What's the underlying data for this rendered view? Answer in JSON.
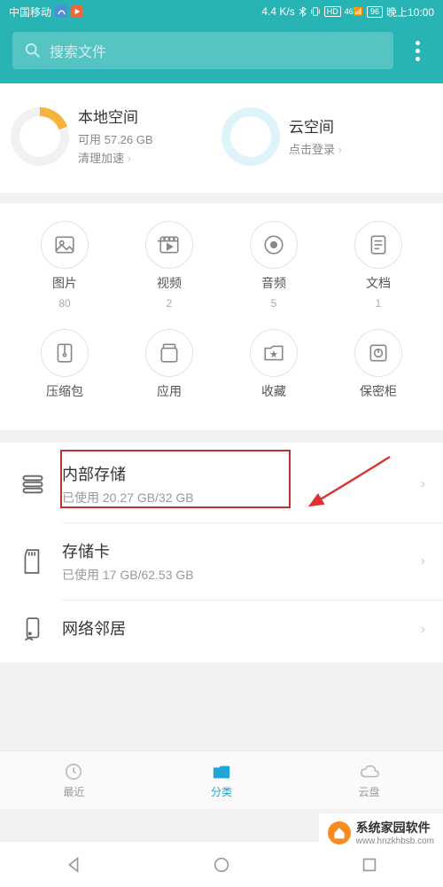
{
  "status": {
    "carrier": "中国移动",
    "netspeed": "4.4 K/s",
    "hd": "HD",
    "signal": "46",
    "battery": "96",
    "time": "晚上10:00"
  },
  "search": {
    "placeholder": "搜索文件"
  },
  "storage": {
    "local": {
      "title": "本地空间",
      "available": "可用 57.26 GB",
      "link": "清理加速"
    },
    "cloud": {
      "title": "云空间",
      "link": "点击登录"
    }
  },
  "categories": [
    {
      "label": "图片",
      "count": "80",
      "icon": "image-icon"
    },
    {
      "label": "视频",
      "count": "2",
      "icon": "video-icon"
    },
    {
      "label": "音频",
      "count": "5",
      "icon": "audio-icon"
    },
    {
      "label": "文档",
      "count": "1",
      "icon": "document-icon"
    },
    {
      "label": "压缩包",
      "count": "",
      "icon": "archive-icon"
    },
    {
      "label": "应用",
      "count": "",
      "icon": "app-icon"
    },
    {
      "label": "收藏",
      "count": "",
      "icon": "favorite-icon"
    },
    {
      "label": "保密柜",
      "count": "",
      "icon": "safe-icon"
    }
  ],
  "locations": {
    "internal": {
      "title": "内部存储",
      "sub": "已使用 20.27 GB/32 GB"
    },
    "sdcard": {
      "title": "存储卡",
      "sub": "已使用 17 GB/62.53 GB"
    },
    "network": {
      "title": "网络邻居"
    }
  },
  "tabs": {
    "recent": "最近",
    "category": "分类",
    "cloud": "云盘"
  },
  "watermark": {
    "text": "系统家园软件",
    "url": "www.hnzkhbsb.com"
  }
}
